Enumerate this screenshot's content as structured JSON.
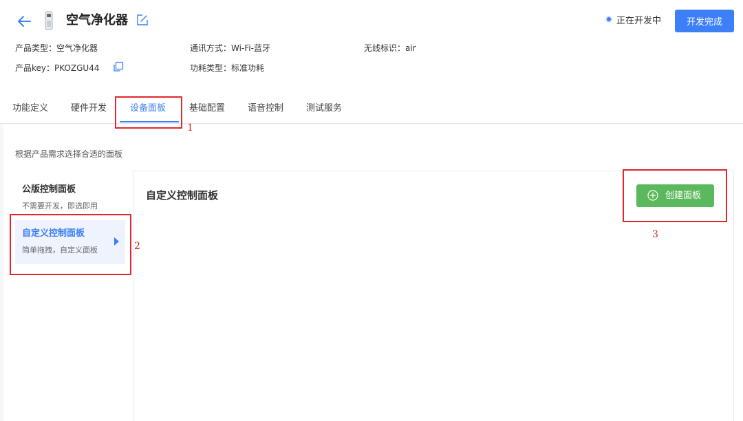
{
  "header": {
    "title": "空气净化器",
    "status": "正在开发中",
    "finish_button": "开发完成"
  },
  "info": {
    "product_type": "产品类型：空气净化器",
    "comm_mode": "通讯方式：Wi-Fi-蓝牙",
    "wireless_id": "无线标识：air",
    "product_key": "产品key：PKOZGU44",
    "power_type": "功耗类型：标准功耗"
  },
  "tabs": [
    {
      "label": "功能定义"
    },
    {
      "label": "硬件开发"
    },
    {
      "label": "设备面板",
      "active": true
    },
    {
      "label": "基础配置"
    },
    {
      "label": "语音控制"
    },
    {
      "label": "测试服务"
    }
  ],
  "content": {
    "hint": "根据产品需求选择合适的面板",
    "sidebar": [
      {
        "title": "公版控制面板",
        "subtitle": "不需要开发，即选即用"
      },
      {
        "title": "自定义控制面板",
        "subtitle": "简单拖拽，自定义面板",
        "active": true
      }
    ],
    "panel_title": "自定义控制面板",
    "create_button": "创建面板"
  },
  "annotations": [
    "1",
    "2",
    "3"
  ],
  "colors": {
    "accent": "#3d7ff7",
    "create": "#5cb85c",
    "annotation": "#e4252b"
  },
  "icons": {
    "back": "arrow-left-icon",
    "device": "air-purifier-icon",
    "edit": "edit-icon",
    "copy": "copy-icon",
    "plus": "plus-circle-icon"
  }
}
